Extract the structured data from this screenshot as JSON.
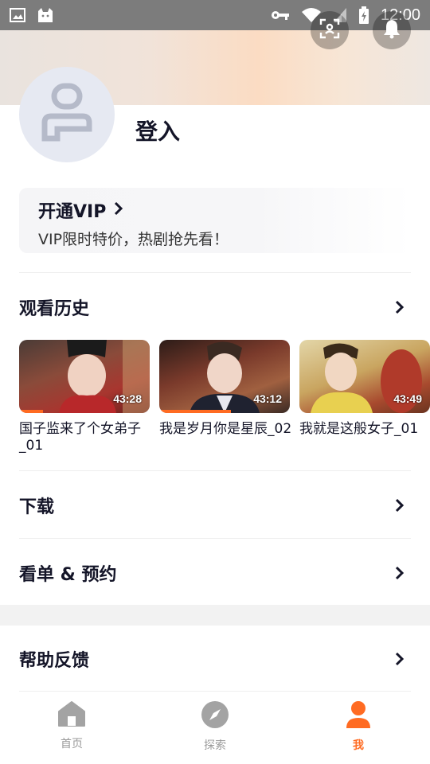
{
  "status_bar": {
    "time": "12:00",
    "icons": [
      "image-icon",
      "cat-icon",
      "key-icon",
      "wifi-icon",
      "signal-icon",
      "battery-charging-icon"
    ]
  },
  "header": {
    "scan_icon": "scan-icon",
    "bell_icon": "bell-icon"
  },
  "profile": {
    "login_label": "登入"
  },
  "vip": {
    "title": "开通VIP",
    "subtitle": "VIP限时特价，热剧抢先看！"
  },
  "sections": {
    "history": {
      "label": "观看历史"
    },
    "download": {
      "label": "下载"
    },
    "watchlist": {
      "label": "看单 & 预约"
    },
    "help": {
      "label": "帮助反馈"
    }
  },
  "history_items": [
    {
      "title": "国子监来了个女弟子_01",
      "duration": "43:28",
      "progress": 0.18
    },
    {
      "title": "我是岁月你是星辰_02",
      "duration": "43:12",
      "progress": 0.55
    },
    {
      "title": "我就是这般女子_01",
      "duration": "43:49",
      "progress": 0.0
    }
  ],
  "tabs": [
    {
      "label": "首页",
      "icon": "home-icon"
    },
    {
      "label": "探索",
      "icon": "compass-icon"
    },
    {
      "label": "我",
      "icon": "person-icon"
    }
  ],
  "colors": {
    "accent": "#ff6b22",
    "text": "#141528",
    "icon_gray": "#9a9a9a"
  }
}
